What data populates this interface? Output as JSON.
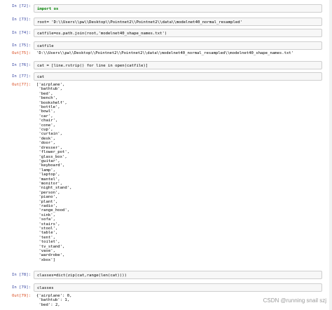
{
  "cells": [
    {
      "prompt": "In  [72]:",
      "code": "import os"
    },
    {
      "prompt": "In  [73]:",
      "code": "root= 'D:\\\\Users\\\\pw\\\\Desktop\\\\Pointnet2\\\\Pointnet2\\\\data\\\\modelnet40_normal_resampled'"
    },
    {
      "prompt": "In  [74]:",
      "code": "catfile=os.path.join(root,'modelnet40_shape_names.txt')"
    },
    {
      "prompt": "In  [75]:",
      "code": "catfile"
    },
    {
      "prompt": "Out[75]:",
      "output": "'D:\\\\Users\\\\pw\\\\Desktop\\\\Pointnet2\\\\Pointnet2\\\\data\\\\modelnet40_normal_resampled\\\\modelnet40_shape_names.txt'"
    },
    {
      "prompt": "In  [76]:",
      "code": "cat = [line.rstrip() for line in open(catfile)]"
    },
    {
      "prompt": "In  [77]:",
      "code": "cat"
    },
    {
      "prompt": "Out[77]:"
    },
    {
      "prompt": "In  [78]:",
      "code": "classes=dict(zip(cat,range(len(cat))))"
    },
    {
      "prompt": "In  [79]:",
      "code": "classes"
    },
    {
      "prompt": "Out[79]:"
    }
  ],
  "cat_list": [
    "['airplane',",
    " 'bathtub',",
    " 'bed',",
    " 'bench',",
    " 'bookshelf',",
    " 'bottle',",
    " 'bowl',",
    " 'car',",
    " 'chair',",
    " 'cone',",
    " 'cup',",
    " 'curtain',",
    " 'desk',",
    " 'door',",
    " 'dresser',",
    " 'flower_pot',",
    " 'glass_box',",
    " 'guitar',",
    " 'keyboard',",
    " 'lamp',",
    " 'laptop',",
    " 'mantel',",
    " 'monitor',",
    " 'night_stand',",
    " 'person',",
    " 'piano',",
    " 'plant',",
    " 'radio',",
    " 'range_hood',",
    " 'sink',",
    " 'sofa',",
    " 'stairs',",
    " 'stool',",
    " 'table',",
    " 'tent',",
    " 'toilet',",
    " 'tv_stand',",
    " 'vase',",
    " 'wardrobe',",
    " 'xbox']"
  ],
  "classes_list": [
    "{'airplane': 0,",
    " 'bathtub': 1,",
    " 'bed': 2,"
  ],
  "watermark": "CSDN @running snail szj"
}
